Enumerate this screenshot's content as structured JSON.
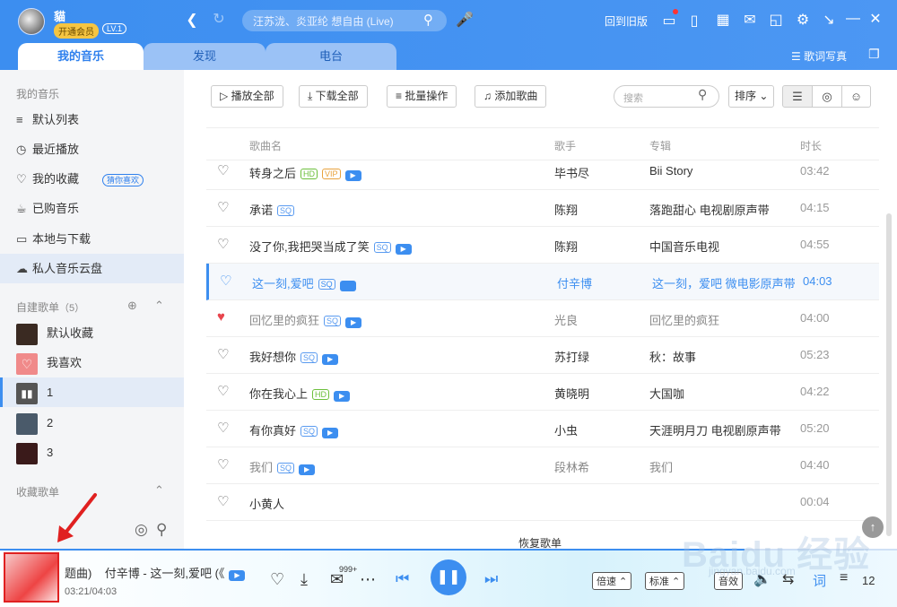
{
  "header": {
    "username": "貓",
    "vip_label": "开通会员",
    "level": "LV.1",
    "search_placeholder": "汪苏泷、炎亚纶 想自由 (Live)",
    "old_version": "回到旧版",
    "lyrics_poster": "歌词写真"
  },
  "tabs": [
    "我的音乐",
    "发现",
    "电台"
  ],
  "sidebar": {
    "section_my_music": "我的音乐",
    "items": [
      {
        "label": "默认列表",
        "icon": "playlist-icon"
      },
      {
        "label": "最近播放",
        "icon": "clock-icon"
      },
      {
        "label": "我的收藏",
        "icon": "heart-icon",
        "pill": "猜你喜欢"
      },
      {
        "label": "已购音乐",
        "icon": "bag-icon"
      },
      {
        "label": "本地与下载",
        "icon": "monitor-icon"
      },
      {
        "label": "私人音乐云盘",
        "icon": "cloud-icon"
      }
    ],
    "created_header": "自建歌单",
    "created_count": "（5）",
    "playlists": [
      {
        "label": "默认收藏",
        "color": "#3a2a22"
      },
      {
        "label": "我喜欢",
        "color": "#f08a8a"
      },
      {
        "label": "1",
        "color": "#555555"
      },
      {
        "label": "2",
        "color": "#4a5a6a"
      },
      {
        "label": "3",
        "color": "#3a1a1a"
      }
    ],
    "collected_header": "收藏歌单"
  },
  "toolbar": {
    "play_all": "播放全部",
    "download_all": "下载全部",
    "batch": "批量操作",
    "add_song": "添加歌曲",
    "search_placeholder": "搜索",
    "sort": "排序"
  },
  "table": {
    "columns": [
      "歌曲名",
      "歌手",
      "专辑",
      "时长"
    ],
    "rows": [
      {
        "title": "转身之后",
        "tags": [
          "HD",
          "VIP"
        ],
        "mv": true,
        "artist": "毕书尽",
        "album": "Bii Story",
        "duration": "03:42",
        "liked": false,
        "gray": false
      },
      {
        "title": "承诺",
        "tags": [
          "SQ"
        ],
        "mv": false,
        "artist": "陈翔",
        "album": "落跑甜心 电视剧原声带",
        "duration": "04:15",
        "liked": false,
        "gray": false
      },
      {
        "title": "没了你,我把哭当成了笑",
        "tags": [
          "SQ"
        ],
        "mv": true,
        "artist": "陈翔",
        "album": "中国音乐电视",
        "duration": "04:55",
        "liked": false,
        "gray": false
      },
      {
        "title": "这一刻,爱吧",
        "tags": [
          "SQ"
        ],
        "mv": true,
        "artist": "付辛博",
        "album": "这一刻，爱吧 微电影原声带",
        "duration": "04:03",
        "liked": false,
        "gray": false,
        "active": true
      },
      {
        "title": "回忆里的疯狂",
        "tags": [
          "SQ"
        ],
        "mv": true,
        "artist": "光良",
        "album": "回忆里的疯狂",
        "duration": "04:00",
        "liked": true,
        "gray": true
      },
      {
        "title": "我好想你",
        "tags": [
          "SQ"
        ],
        "mv": true,
        "artist": "苏打绿",
        "album": "秋：故事",
        "duration": "05:23",
        "liked": false,
        "gray": false
      },
      {
        "title": "你在我心上",
        "tags": [
          "HD"
        ],
        "mv": true,
        "artist": "黄晓明",
        "album": "大国咖",
        "duration": "04:22",
        "liked": false,
        "gray": false
      },
      {
        "title": "有你真好",
        "tags": [
          "SQ"
        ],
        "mv": true,
        "artist": "小虫",
        "album": "天涯明月刀 电视剧原声带",
        "duration": "05:20",
        "liked": false,
        "gray": false
      },
      {
        "title": "我们",
        "tags": [
          "SQ"
        ],
        "mv": true,
        "artist": "段林希",
        "album": "我们",
        "duration": "04:40",
        "liked": false,
        "gray": true
      },
      {
        "title": "小黄人",
        "tags": [],
        "mv": false,
        "artist": "",
        "album": "",
        "duration": "00:04",
        "liked": false,
        "gray": false
      }
    ],
    "restore": "恢复歌单"
  },
  "player": {
    "track_prefix": "题曲)",
    "track": "付辛博 - 这一刻,爱吧 (《",
    "time": "03:21/04:03",
    "comment_count": "999+",
    "speed": "倍速",
    "quality": "标准",
    "effect": "音效",
    "lyric": "词",
    "queue_count": "12",
    "progress": 0.83
  },
  "watermark": "Baidu 经验",
  "watermark_url": "jingyan.baidu.com"
}
